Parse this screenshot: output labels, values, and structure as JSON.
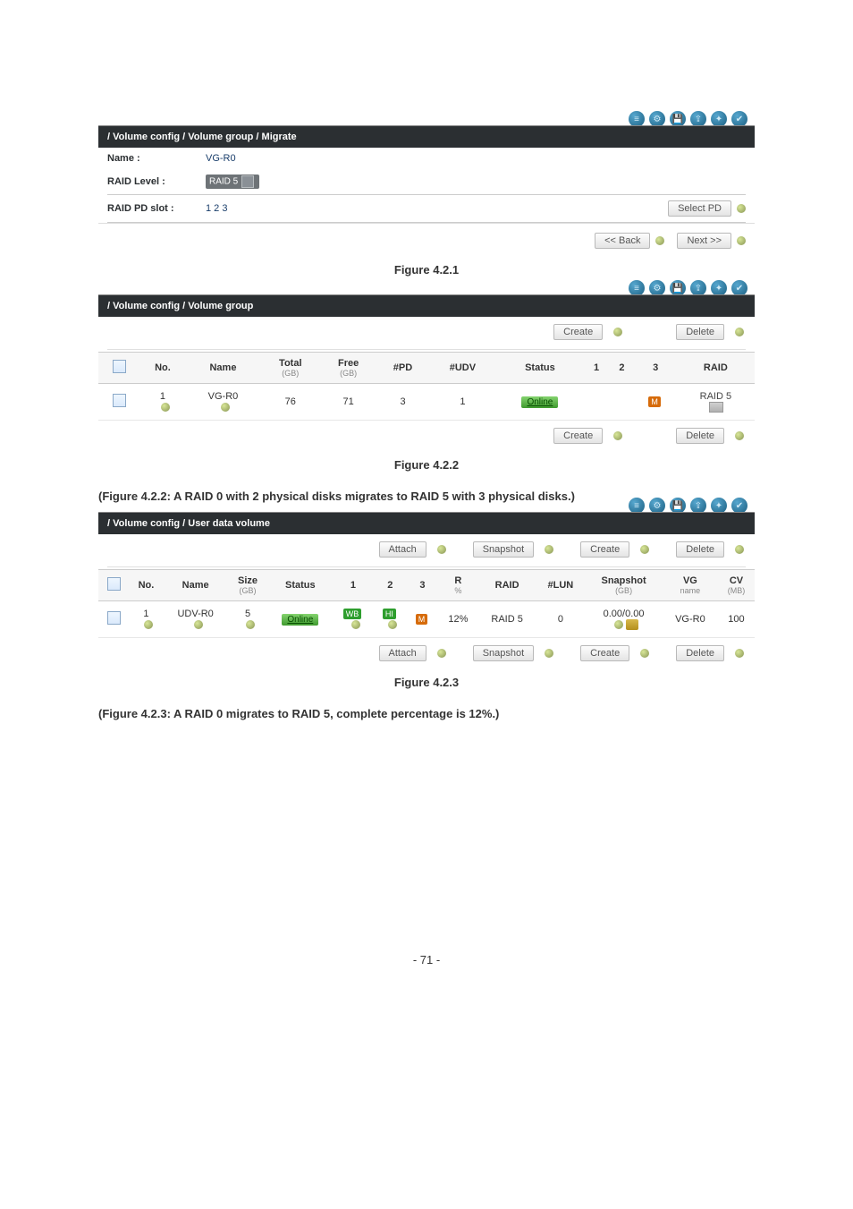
{
  "figure1": {
    "breadcrumb": "/ Volume config / Volume group / Migrate",
    "fields": {
      "name_label": "Name :",
      "name_value": "VG-R0",
      "raid_level_label": "RAID Level :",
      "raid_level_value": "RAID 5",
      "raid_pd_slot_label": "RAID PD slot :",
      "raid_pd_slot_value": "1 2 3"
    },
    "buttons": {
      "select_pd": "Select PD",
      "back": "<< Back",
      "next": "Next >>"
    },
    "caption": "Figure 4.2.1"
  },
  "figure2": {
    "breadcrumb": "/ Volume config / Volume group",
    "buttons": {
      "create": "Create",
      "delete": "Delete"
    },
    "headers": {
      "no": "No.",
      "name": "Name",
      "total": "Total",
      "total_sub": "(GB)",
      "free": "Free",
      "free_sub": "(GB)",
      "pd": "#PD",
      "udv": "#UDV",
      "status": "Status",
      "c1": "1",
      "c2": "2",
      "c3": "3",
      "raid": "RAID"
    },
    "row": {
      "no": "1",
      "name": "VG-R0",
      "total": "76",
      "free": "71",
      "pd": "3",
      "udv": "1",
      "status": "Online",
      "c3_tag": "M",
      "raid": "RAID 5"
    },
    "caption": "Figure 4.2.2",
    "description": "(Figure 4.2.2: A RAID 0 with 2 physical disks migrates to RAID 5 with 3 physical disks.)"
  },
  "figure3": {
    "breadcrumb": "/ Volume config / User data volume",
    "buttons": {
      "attach": "Attach",
      "snapshot": "Snapshot",
      "create": "Create",
      "delete": "Delete"
    },
    "headers": {
      "no": "No.",
      "name": "Name",
      "size": "Size",
      "size_sub": "(GB)",
      "status": "Status",
      "c1": "1",
      "c2": "2",
      "c3": "3",
      "r": "R",
      "r_sub": "%",
      "raid": "RAID",
      "lun": "#LUN",
      "snapshot": "Snapshot",
      "snapshot_sub": "(GB)",
      "vg": "VG",
      "vg_sub": "name",
      "cv": "CV",
      "cv_sub": "(MB)"
    },
    "row": {
      "no": "1",
      "name": "UDV-R0",
      "size": "5",
      "status": "Online",
      "c1_tag": "WB",
      "c2_tag": "HI",
      "c3_tag": "M",
      "r": "12%",
      "raid": "RAID 5",
      "lun": "0",
      "snapshot": "0.00/0.00",
      "vg": "VG-R0",
      "cv": "100"
    },
    "caption": "Figure 4.2.3",
    "description": "(Figure 4.2.3: A RAID 0 migrates to RAID 5, complete percentage is 12%.)"
  },
  "page_number": "- 71 -",
  "header_icons": [
    "≡",
    "⚙",
    "💾",
    "⇪",
    "✦",
    "✔"
  ]
}
